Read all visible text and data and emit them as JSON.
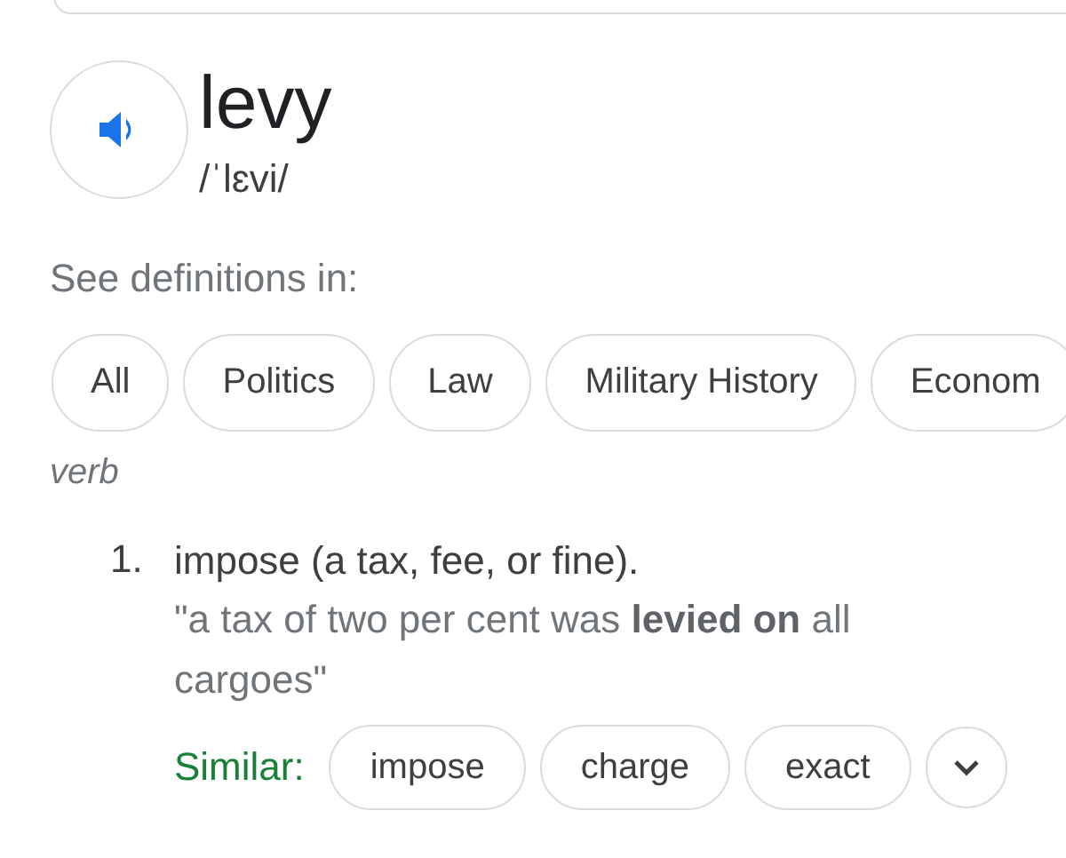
{
  "entry": {
    "word": "levy",
    "phonetic": "/ˈlɛvi/"
  },
  "definitions_in": {
    "label": "See definitions in:",
    "chips": [
      {
        "label": "All"
      },
      {
        "label": "Politics"
      },
      {
        "label": "Law"
      },
      {
        "label": "Military History"
      },
      {
        "label": "Econom"
      }
    ]
  },
  "part_of_speech": "verb",
  "senses": [
    {
      "number": "1.",
      "definition": "impose (a tax, fee, or fine).",
      "example": "\"a tax of two per cent was **levied on** all cargoes\"",
      "similar_label": "Similar:",
      "similar": [
        "impose",
        "charge",
        "exact"
      ]
    }
  ]
}
